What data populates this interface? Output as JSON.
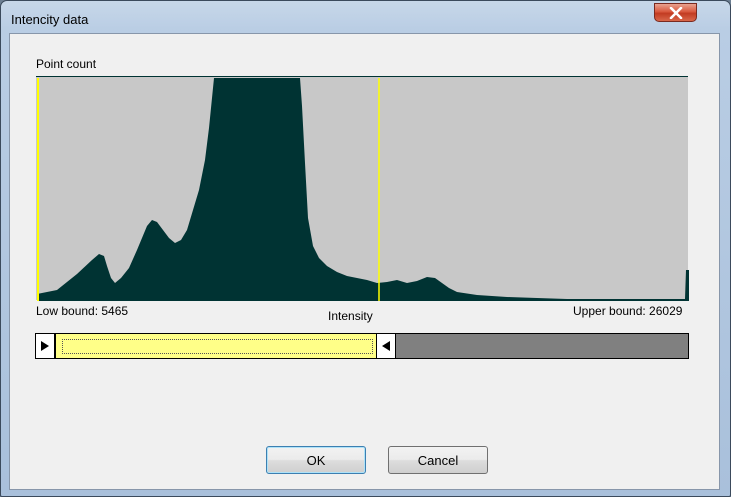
{
  "window": {
    "title": "Intencity data"
  },
  "histogram": {
    "y_label": "Point count",
    "x_label": "Intensity",
    "low_bound_label": "Low bound: 5465",
    "upper_bound_label": "Upper bound: 26029",
    "fill_color": "#003333",
    "background_color": "#c8c8c8",
    "marker_color": "#ffff00"
  },
  "range_slider": {
    "selected_color": "#ffff88",
    "track_color": "#808080"
  },
  "buttons": {
    "ok": "OK",
    "cancel": "Cancel"
  },
  "icons": {
    "close": "close-icon",
    "left_thumb": "triangle-right-icon",
    "right_thumb": "triangle-left-icon"
  }
}
